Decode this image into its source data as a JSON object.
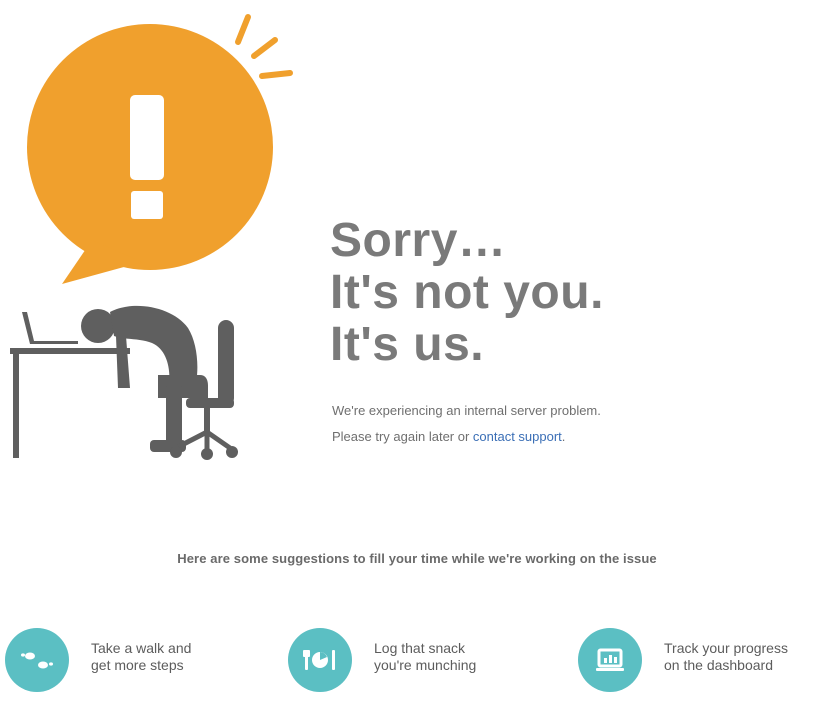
{
  "error": {
    "headline": [
      "Sorry…",
      "It's not you.",
      "It's us."
    ],
    "message_line1": "We're experiencing an internal server problem.",
    "message_line2_prefix": "Please try again later or ",
    "contact_link": "contact support",
    "message_line2_suffix": "."
  },
  "suggestions": {
    "heading": "Here are some suggestions to fill your time while we're working on the issue",
    "items": [
      {
        "line1": "Take a walk and",
        "line2": "get more steps",
        "icon": "footsteps-icon"
      },
      {
        "line1": "Log that snack",
        "line2": "you're munching",
        "icon": "food-plate-icon"
      },
      {
        "line1": "Track your progress",
        "line2": "on the dashboard",
        "icon": "dashboard-monitor-icon"
      }
    ]
  },
  "colors": {
    "alert_orange": "#f0a02d",
    "figure_gray": "#5f5f5f",
    "teal": "#5bbfc3",
    "link_blue": "#3b6fb6",
    "text_gray": "#7a7a7a"
  }
}
